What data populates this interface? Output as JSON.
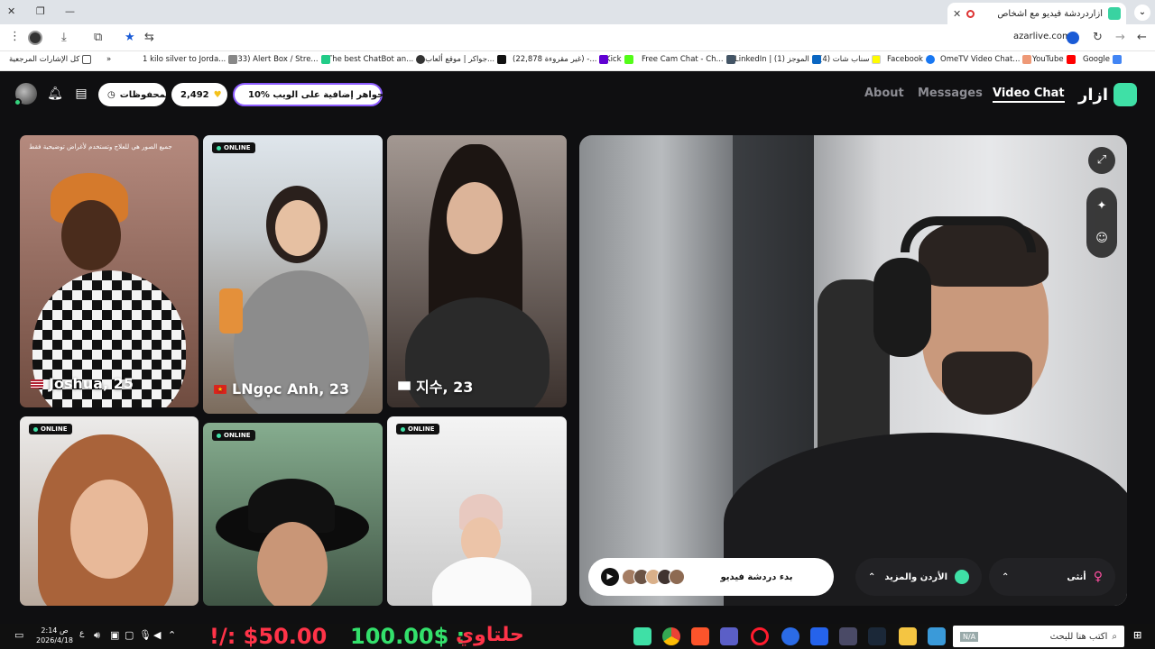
{
  "browser": {
    "tab_title": "أزاردردشة فيديو مع أشخاص",
    "tab_close": "✕",
    "new_tab": "+",
    "tab_menu": "⌄",
    "win_min": "—",
    "win_max": "❐",
    "win_close": "✕",
    "url": "azarlive.com",
    "bookmarks": [
      {
        "label": "Google"
      },
      {
        "label": "YouTube"
      },
      {
        "label": "OmeTV Video Chat..."
      },
      {
        "label": "Facebook"
      },
      {
        "label": "(4) سناب شات"
      },
      {
        "label": "LinkedIn | (1) الموجز"
      },
      {
        "label": "Free Cam Chat - Ch..."
      },
      {
        "label": "Kick"
      },
      {
        "label": "(22,878 غير مقروءة) -..."
      },
      {
        "label": "جواكر | موقع ألعاب ا..."
      },
      {
        "label": "The best ChatBot an..."
      },
      {
        "label": "(33) Alert Box / Stre..."
      },
      {
        "label": "1 kilo silver to Jorda..."
      },
      {
        "label": "»"
      },
      {
        "label": "كل الإشارات المرجعية"
      }
    ]
  },
  "header": {
    "logo_text": "ازار",
    "nav": [
      "Video Chat",
      "Messages",
      "About"
    ],
    "promo": "10% جواهر إضافية على الويب!",
    "gems": "2,492",
    "saved": "المحفوظات"
  },
  "profiles": [
    {
      "name": "Joshua, 25",
      "online": "",
      "notice": "جميع الصور هي للعلاج وتستخدم لأغراض توضيحية فقط",
      "flag_colors": [
        "#b22234",
        "#fff"
      ],
      "bg": [
        "#b0867a",
        "#6d4b40"
      ]
    },
    {
      "name": "LNgọc Anh, 23",
      "online": "ONLINE",
      "notice": "",
      "flag_colors": [
        "#da251d",
        "#ffcd00"
      ],
      "bg": [
        "#d8dfe6",
        "#7a6a5e"
      ]
    },
    {
      "name": "지수, 23",
      "online": "",
      "notice": "",
      "flag_colors": [
        "#ffffff",
        "#cd2e3a"
      ],
      "bg": [
        "#9a8f88",
        "#3a302c"
      ]
    },
    {
      "name": "",
      "online": "ONLINE",
      "notice": "",
      "flag_colors": [],
      "bg": [
        "#e8e6e3",
        "#b5a59a"
      ]
    },
    {
      "name": "",
      "online": "ONLINE",
      "notice": "",
      "flag_colors": [],
      "bg": [
        "#7fa389",
        "#3b4b3f"
      ]
    },
    {
      "name": "",
      "online": "ONLINE",
      "notice": "",
      "flag_colors": [],
      "bg": [
        "#f2f2f2",
        "#cfcfcf"
      ]
    }
  ],
  "controls": {
    "start": "بدء دردشة فيديو",
    "region": "الأردن والمزيد",
    "gender": "أنثى"
  },
  "taskbar": {
    "time": "2:14 ص",
    "date": "2026/4/18",
    "lang": "ع",
    "search_placeholder": "اكتب هنا للبحث",
    "ticker_red": "!/: $50.00",
    "ticker_green": "100.00$ :",
    "ticker_label": "حلتاوي",
    "badge": "N/A"
  },
  "colors": {
    "accent": "#3fe0a6",
    "promo_border": "#8c5bff",
    "ticker_red": "#ff3348",
    "ticker_green": "#33e06b"
  }
}
